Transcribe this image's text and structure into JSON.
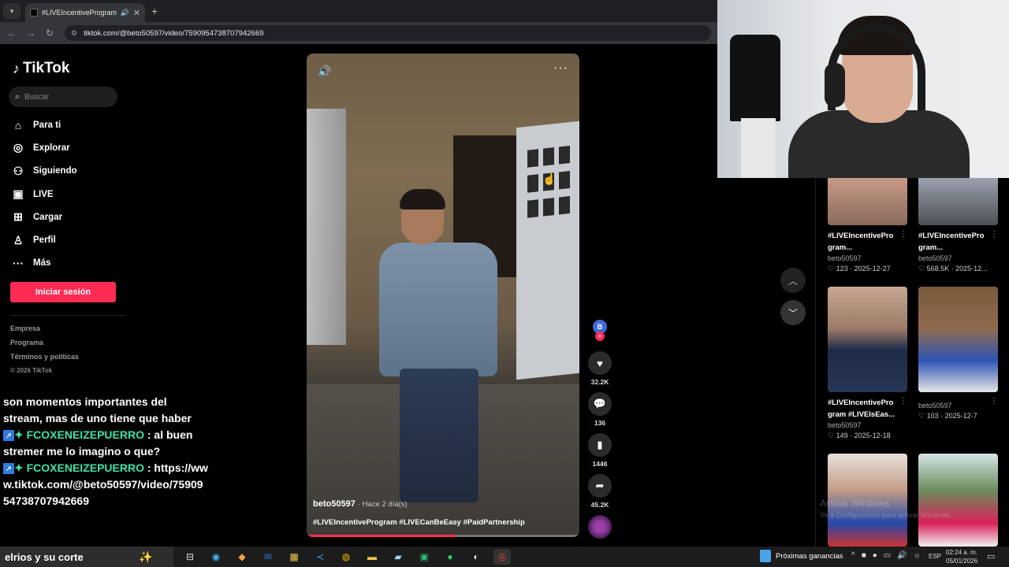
{
  "browser": {
    "tab_title": "#LIVEIncentiveProgram #LI",
    "url": "tiktok.com/@beto50597/video/7590954738707942669"
  },
  "sidebar": {
    "brand": "TikTok",
    "search_placeholder": "Buscar",
    "items": [
      {
        "label": "Para ti",
        "icon": "home-icon"
      },
      {
        "label": "Explorar",
        "icon": "compass-icon"
      },
      {
        "label": "Siguiendo",
        "icon": "following-icon"
      },
      {
        "label": "LIVE",
        "icon": "live-icon"
      },
      {
        "label": "Cargar",
        "icon": "upload-icon"
      },
      {
        "label": "Perfil",
        "icon": "profile-icon"
      },
      {
        "label": "Más",
        "icon": "more-icon"
      }
    ],
    "login_label": "Iniciar sesión",
    "footer": [
      "Empresa",
      "Programa",
      "Términos y políticas",
      "© 2026 TikTok"
    ]
  },
  "video": {
    "author": "beto50597",
    "posted": "· Hace 2 día(s)",
    "caption": "#LIVEIncentiveProgram #LIVECanBeEasy #PaidPartnership",
    "progress_fraction": 0.55,
    "avatar_letter": "B",
    "likes": "32.2K",
    "comments": "136",
    "saves": "1446",
    "shares": "45.2K"
  },
  "grid": {
    "cards": [
      {
        "title": "#LIVEIncentivePro gram...",
        "user": "beto50597",
        "meta": "♡ 123 · 2025-12-27"
      },
      {
        "title": "#LIVEIncentivePro gram...",
        "user": "beto50597",
        "meta": "♡ 568.5K · 2025-12..."
      },
      {
        "title": "#LIVEIncentivePro gram #LIVEIsEas...",
        "user": "beto50597",
        "meta": "♡ 149 · 2025-12-18"
      },
      {
        "title": "",
        "user": "beto50597",
        "meta": "♡ 103 · 2025-12-7"
      }
    ],
    "watermark": "Activar Windows",
    "watermark_sub": "Ve a Configuración para activar Windows."
  },
  "chat": {
    "msg1": "son momentos importantes del stream, mas de uno tiene que haber",
    "user2": "FCOXENEIZEPUERRO",
    "msg2": ": al buen stremer me lo imagino o que?",
    "user3": "FCOXENEIZEPUERRO",
    "msg3": ": https://www.tiktok.com/@beto50597/video/7590954738707942669"
  },
  "taskbar": {
    "search_text": "elrios y su corte",
    "news": "Próximas ganancias",
    "lang": "ESP",
    "time": "02:24 a. m.",
    "date": "05/01/2026"
  }
}
